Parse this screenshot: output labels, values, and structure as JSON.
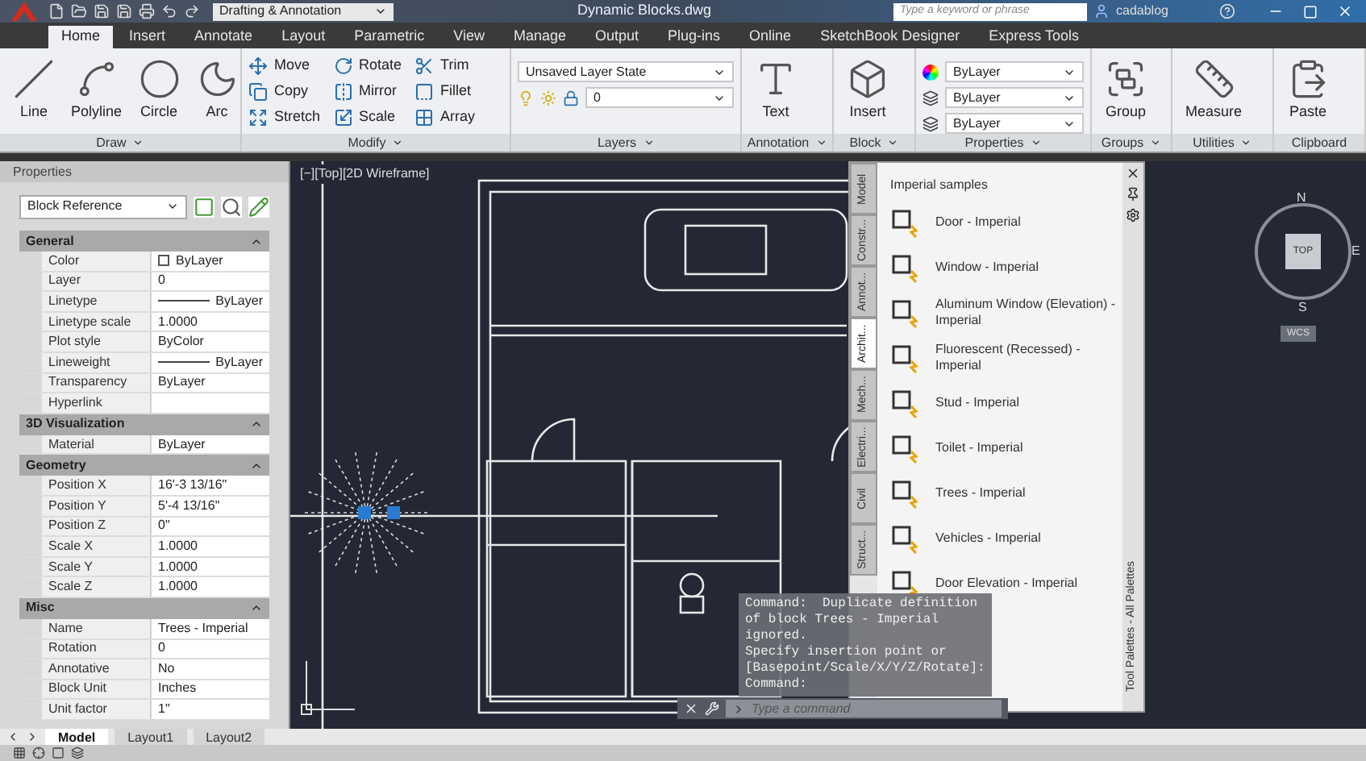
{
  "title_bar": {
    "workspace": "Drafting & Annotation",
    "document_title": "Dynamic Blocks.dwg",
    "search": {
      "placeholder": "Type a keyword or phrase"
    },
    "user": "cadablog"
  },
  "ribbon_tabs": [
    {
      "label": "Home",
      "selected": true
    },
    {
      "label": "Insert",
      "selected": false
    },
    {
      "label": "Annotate",
      "selected": false
    },
    {
      "label": "Layout",
      "selected": false
    },
    {
      "label": "Parametric",
      "selected": false
    },
    {
      "label": "View",
      "selected": false
    },
    {
      "label": "Manage",
      "selected": false
    },
    {
      "label": "Output",
      "selected": false
    },
    {
      "label": "Plug-ins",
      "selected": false
    },
    {
      "label": "Online",
      "selected": false
    },
    {
      "label": "SketchBook Designer",
      "selected": false
    },
    {
      "label": "Express Tools",
      "selected": false
    }
  ],
  "ribbon_panels": [
    {
      "title": "Draw",
      "menu": true,
      "tools": [
        {
          "kind": "large",
          "label": "Line"
        },
        {
          "kind": "large",
          "label": "Polyline"
        },
        {
          "kind": "large",
          "label": "Circle"
        },
        {
          "kind": "large",
          "label": "Arc"
        }
      ]
    },
    {
      "title": "Modify",
      "menu": true,
      "tools": [
        {
          "kind": "small",
          "label": "Move"
        },
        {
          "kind": "small",
          "label": "Copy"
        },
        {
          "kind": "small",
          "label": "Stretch"
        },
        {
          "kind": "small",
          "label": "Rotate"
        },
        {
          "kind": "small",
          "label": "Mirror"
        },
        {
          "kind": "small",
          "label": "Scale"
        },
        {
          "kind": "small",
          "label": "Trim"
        },
        {
          "kind": "small",
          "label": "Fillet"
        },
        {
          "kind": "small",
          "label": "Array"
        }
      ]
    },
    {
      "title": "Layers",
      "menu": true,
      "tools": [
        {
          "kind": "dropdown",
          "label": "Unsaved Layer State"
        },
        {
          "kind": "dropdown",
          "label": "0"
        }
      ]
    },
    {
      "title": "Annotation",
      "menu": true,
      "tools": [
        {
          "kind": "large",
          "label": "Text"
        }
      ]
    },
    {
      "title": "Block",
      "menu": true,
      "tools": [
        {
          "kind": "large",
          "label": "Insert"
        }
      ]
    },
    {
      "title": "Properties",
      "menu": true,
      "tools": [
        {
          "kind": "dropdown",
          "label": "ByLayer"
        },
        {
          "kind": "dropdown",
          "label": "ByLayer"
        },
        {
          "kind": "dropdown",
          "label": "ByLayer"
        }
      ]
    },
    {
      "title": "Groups",
      "menu": true,
      "tools": [
        {
          "kind": "large",
          "label": "Group"
        }
      ]
    },
    {
      "title": "Utilities",
      "menu": true,
      "tools": [
        {
          "kind": "large",
          "label": "Measure"
        }
      ]
    },
    {
      "title": "Clipboard",
      "menu": false,
      "tools": [
        {
          "kind": "large",
          "label": "Paste"
        }
      ]
    }
  ],
  "properties_palette": {
    "title": "Properties",
    "object_type": "Block Reference",
    "sections": [
      {
        "title": "General",
        "expanded": true,
        "rows": [
          {
            "label": "Color",
            "value": "ByLayer",
            "kind": "color"
          },
          {
            "label": "Layer",
            "value": "0",
            "kind": "text"
          },
          {
            "label": "Linetype",
            "value": "ByLayer",
            "kind": "line"
          },
          {
            "label": "Linetype scale",
            "value": "1.0000",
            "kind": "text"
          },
          {
            "label": "Plot style",
            "value": "ByColor",
            "kind": "text"
          },
          {
            "label": "Lineweight",
            "value": "ByLayer",
            "kind": "line"
          },
          {
            "label": "Transparency",
            "value": "ByLayer",
            "kind": "text"
          },
          {
            "label": "Hyperlink",
            "value": "",
            "kind": "text"
          }
        ]
      },
      {
        "title": "3D Visualization",
        "expanded": true,
        "rows": [
          {
            "label": "Material",
            "value": "ByLayer",
            "kind": "text"
          }
        ]
      },
      {
        "title": "Geometry",
        "expanded": true,
        "rows": [
          {
            "label": "Position X",
            "value": "16'-3 13/16\"",
            "kind": "text"
          },
          {
            "label": "Position Y",
            "value": "5'-4 13/16\"",
            "kind": "text"
          },
          {
            "label": "Position Z",
            "value": "0\"",
            "kind": "text"
          },
          {
            "label": "Scale X",
            "value": "1.0000",
            "kind": "text"
          },
          {
            "label": "Scale Y",
            "value": "1.0000",
            "kind": "text"
          },
          {
            "label": "Scale Z",
            "value": "1.0000",
            "kind": "text"
          }
        ]
      },
      {
        "title": "Misc",
        "expanded": true,
        "rows": [
          {
            "label": "Name",
            "value": "Trees - Imperial",
            "kind": "text"
          },
          {
            "label": "Rotation",
            "value": "0",
            "kind": "text"
          },
          {
            "label": "Annotative",
            "value": "No",
            "kind": "text"
          },
          {
            "label": "Block Unit",
            "value": "Inches",
            "kind": "text"
          },
          {
            "label": "Unit factor",
            "value": "1\"",
            "kind": "text"
          }
        ]
      }
    ]
  },
  "viewport_label": "[−][Top][2D Wireframe]",
  "viewcube": {
    "north": "N",
    "east": "E",
    "south": "S",
    "face": "TOP",
    "ucs": "WCS"
  },
  "tool_palette": {
    "side_title": "Tool Palettes - All Palettes",
    "tabs": [
      {
        "label": "Model",
        "selected": false
      },
      {
        "label": "Constr...",
        "selected": false
      },
      {
        "label": "Annot...",
        "selected": false
      },
      {
        "label": "Archit...",
        "selected": true
      },
      {
        "label": "Mech...",
        "selected": false
      },
      {
        "label": "Electri...",
        "selected": false
      },
      {
        "label": "Civil",
        "selected": false
      },
      {
        "label": "Struct...",
        "selected": false
      }
    ],
    "heading": "Imperial samples",
    "items": [
      {
        "label": "Door - Imperial"
      },
      {
        "label": "Window - Imperial"
      },
      {
        "label": "Aluminum Window (Elevation) - Imperial"
      },
      {
        "label": "Fluorescent (Recessed) - Imperial"
      },
      {
        "label": "Stud - Imperial"
      },
      {
        "label": "Toilet - Imperial"
      },
      {
        "label": "Trees - Imperial"
      },
      {
        "label": "Vehicles - Imperial"
      },
      {
        "label": "Door Elevation - Imperial"
      }
    ]
  },
  "command_history": [
    "Command:  Duplicate definition",
    "of block Trees - Imperial",
    "ignored.",
    "Specify insertion point or",
    "[Basepoint/Scale/X/Y/Z/Rotate]:",
    "Command:"
  ],
  "command_line": {
    "placeholder": "Type a command"
  },
  "layout_tabs": [
    {
      "label": "Model",
      "selected": true
    },
    {
      "label": "Layout1",
      "selected": false
    },
    {
      "label": "Layout2",
      "selected": false
    }
  ]
}
